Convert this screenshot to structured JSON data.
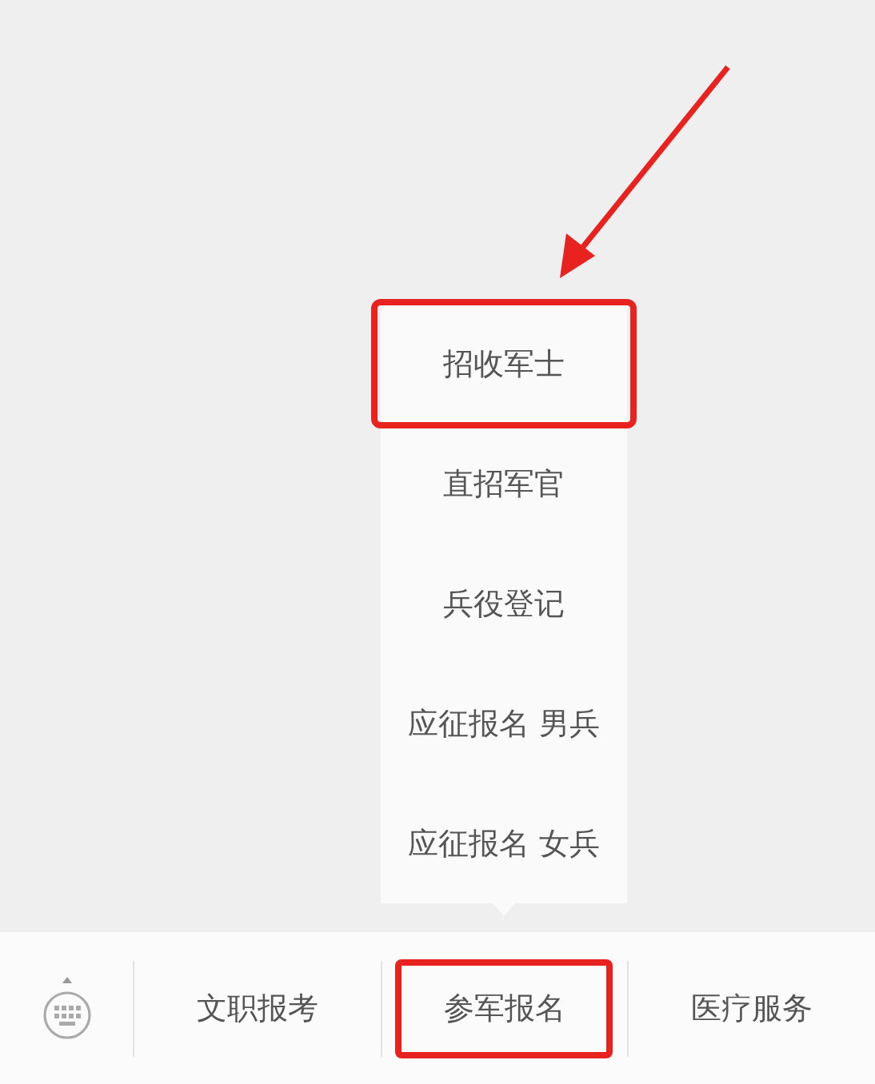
{
  "menu": {
    "items": [
      {
        "label": "招收军士",
        "highlighted": true
      },
      {
        "label": "直招军官",
        "highlighted": false
      },
      {
        "label": "兵役登记",
        "highlighted": false
      },
      {
        "label": "应征报名 男兵",
        "highlighted": false
      },
      {
        "label": "应征报名 女兵",
        "highlighted": false
      }
    ]
  },
  "bottom_bar": {
    "tabs": [
      {
        "label": "文职报考",
        "highlighted": false
      },
      {
        "label": "参军报名",
        "highlighted": true
      },
      {
        "label": "医疗服务",
        "highlighted": false
      }
    ]
  }
}
